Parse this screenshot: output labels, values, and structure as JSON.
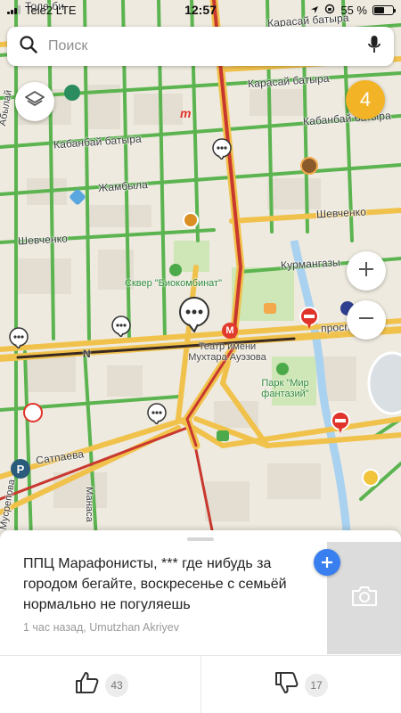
{
  "status_bar": {
    "carrier": "Tele2 LTE",
    "time": "12:57",
    "battery": "55 %",
    "battery_level": 0.55
  },
  "search": {
    "placeholder": "Поиск"
  },
  "map": {
    "traffic_score": "4",
    "streets": {
      "karasay": "Карасай батыра",
      "karasay_top": "Карасай батыра",
      "kabanbay_left": "Кабанбай батыра",
      "kabanbay_right": "Кабанбай батыра",
      "zhambyla": "Жамбыла",
      "shevchenko_left": "Шевченко",
      "shevchenko_right": "Шевченко",
      "kurmangazy": "Курмангазы",
      "prospekt": "проспект",
      "satpaeva": "Сатпаева",
      "manasa": "Манаса",
      "abylay": "Абылай",
      "musrepov": "Мусрепова",
      "tole_bi": "Толе би"
    },
    "places": {
      "park_biokombinat": "Сквер \"Биокомбинат\"",
      "theatre": "Театр имени Мухтара Ауэзова",
      "park_fantasy": "Парк \"Мир фантазий\""
    },
    "metro_label": "М",
    "letter_n": "N"
  },
  "comment": {
    "text": "ППЦ Марафонисты, *** где нибудь за городом бегайте, воскресенье с семьёй нормально не погуляешь",
    "meta": "1 час назад, Umutzhan Akriyev",
    "likes": "43",
    "dislikes": "17"
  },
  "colors": {
    "traffic_green": "#5bb44f",
    "traffic_yellow": "#f1c24b",
    "traffic_red": "#c8382f",
    "map_bg": "#eeeadf",
    "accent_blue": "#3a7ff0",
    "traffic_badge": "#f2b327"
  }
}
